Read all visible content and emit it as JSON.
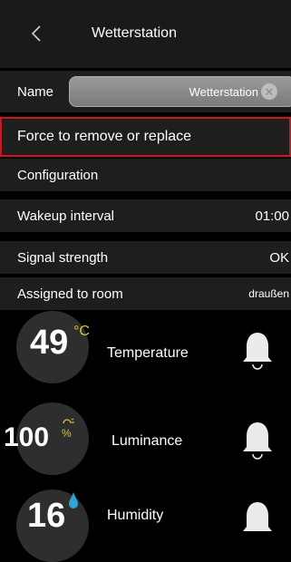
{
  "header": {
    "title": "Wetterstation",
    "back_icon": "chevron-left-icon"
  },
  "name_row": {
    "label": "Name",
    "value": "Wetterstation",
    "clear_icon": "clear-icon"
  },
  "force_row": {
    "label": "Force to remove or replace",
    "highlight_color": "#d0161c"
  },
  "configuration": {
    "label": "Configuration"
  },
  "wakeup": {
    "label": "Wakeup interval",
    "value": "01:00"
  },
  "signal": {
    "label": "Signal strength",
    "value": "OK"
  },
  "room": {
    "label": "Assigned to room",
    "value": "draußen"
  },
  "sensors": [
    {
      "value": "49",
      "unit": "°C",
      "label": "Temperature",
      "icon": "thermometer-unit-icon",
      "alarm_icon": "bell-icon"
    },
    {
      "value": "100",
      "unit": "%",
      "label": "Luminance",
      "icon": "luminance-unit-icon",
      "alarm_icon": "bell-icon"
    },
    {
      "value": "16",
      "unit": "",
      "label": "Humidity",
      "icon": "water-drop-icon",
      "alarm_icon": "bell-icon"
    }
  ],
  "colors": {
    "accent_yellow": "#e3c21f",
    "drop_blue": "#2aa6d8"
  }
}
